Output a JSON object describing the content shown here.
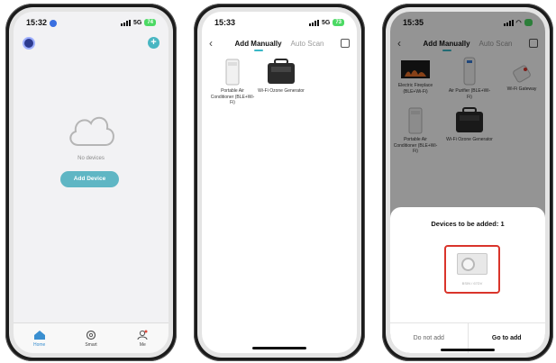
{
  "phone1": {
    "status": {
      "time": "15:32",
      "network": "5G",
      "battery": "74"
    },
    "empty_text": "No devices",
    "add_button": "Add Device",
    "tabs": [
      {
        "label": "Home",
        "icon": "home-icon",
        "active": true
      },
      {
        "label": "Smart",
        "icon": "gear-icon",
        "active": false
      },
      {
        "label": "Me",
        "icon": "person-icon",
        "active": false
      }
    ],
    "accent": "#5fb6c4"
  },
  "phone2": {
    "status": {
      "time": "15:33",
      "network": "5G",
      "battery": "73"
    },
    "tabs": {
      "manual": "Add Manually",
      "scan": "Auto Scan"
    },
    "devices": [
      {
        "name": "Portable Air Conditioner (BLE+Wi-Fi)"
      },
      {
        "name": "Wi-Fi Ozone Generator"
      }
    ]
  },
  "phone3": {
    "status": {
      "time": "15:35"
    },
    "tabs": {
      "manual": "Add Manually",
      "scan": "Auto Scan"
    },
    "devices": [
      {
        "name": "Electric Fireplace (BLE+Wi-Fi)"
      },
      {
        "name": "Air Purifier (BLE+Wi-Fi)"
      },
      {
        "name": "Wi-Fi Gateway"
      },
      {
        "name": "Portable Air Conditioner (BLE+Wi-Fi)"
      },
      {
        "name": "Wi-Fi Ozone Generator"
      }
    ],
    "sheet": {
      "title": "Devices to be added: 1",
      "device_label": "BSIN / 67DV",
      "cancel": "Do not add",
      "confirm": "Go to add"
    },
    "highlight": "#d9342b"
  }
}
